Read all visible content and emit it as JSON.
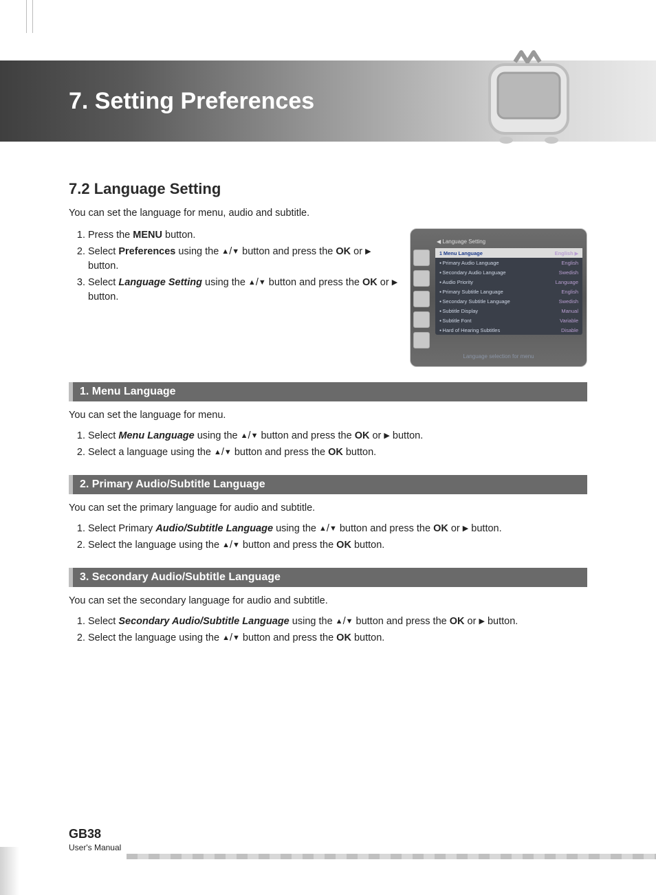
{
  "chapter_title": "7. Setting Preferences",
  "section_heading": "7.2 Language Setting",
  "section_intro": "You can set the language for menu, audio and subtitle.",
  "steps": {
    "s1_a": "Press the ",
    "s1_b": "MENU",
    "s1_c": " button.",
    "s2_a": "Select ",
    "s2_b": "Preferences",
    "s2_c": " using the ",
    "s2_d": " button and press the ",
    "s2_e": "OK",
    "s2_f": " or ",
    "s2_g": " button.",
    "s3_a": "Select ",
    "s3_b": "Language Setting",
    "s3_c": " using the ",
    "s3_d": " button and press the ",
    "s3_e": "OK",
    "s3_f": " or ",
    "s3_g": " button."
  },
  "osd": {
    "crumb": "◀ Language Setting",
    "rows": [
      {
        "label": "Menu Language",
        "value": "English"
      },
      {
        "label": "Primary Audio Language",
        "value": "English"
      },
      {
        "label": "Secondary Audio Language",
        "value": "Swedish"
      },
      {
        "label": "Audio Priority",
        "value": "Language"
      },
      {
        "label": "Primary Subtitle Language",
        "value": "English"
      },
      {
        "label": "Secondary Subtitle Language",
        "value": "Swedish"
      },
      {
        "label": "Subtitle Display",
        "value": "Manual"
      },
      {
        "label": "Subtitle Font",
        "value": "Variable"
      },
      {
        "label": "Hard of Hearing Subtitles",
        "value": "Disable"
      }
    ],
    "help": "Language selection for menu"
  },
  "sub1": {
    "bar": "1. Menu Language",
    "text": "You can set the language for menu.",
    "li1_a": "Select ",
    "li1_b": "Menu Language",
    "li1_c": " using the ",
    "li1_d": " button and press the ",
    "li1_e": "OK",
    "li1_f": " or ",
    "li1_g": " button.",
    "li2_a": "Select a language using the ",
    "li2_b": " button and press the ",
    "li2_c": "OK",
    "li2_d": " button."
  },
  "sub2": {
    "bar": "2. Primary Audio/Subtitle Language",
    "text": "You can set the primary language for audio and subtitle.",
    "li1_a": "Select Primary ",
    "li1_b": "Audio/Subtitle Language",
    "li1_c": " using the ",
    "li1_d": " button and press the ",
    "li1_e": "OK",
    "li1_f": " or ",
    "li1_g": " button.",
    "li2_a": "Select the language using the ",
    "li2_b": " button and press the ",
    "li2_c": "OK",
    "li2_d": " button."
  },
  "sub3": {
    "bar": "3. Secondary Audio/Subtitle Language",
    "text": "You can set the secondary language for audio and subtitle.",
    "li1_a": "Select ",
    "li1_b": "Secondary Audio/Subtitle Language",
    "li1_c": " using the ",
    "li1_d": " button and press the ",
    "li1_e": "OK",
    "li1_f": " or ",
    "li1_g": " button.",
    "li2_a": "Select the language using the ",
    "li2_b": " button and press the ",
    "li2_c": "OK",
    "li2_d": " button."
  },
  "footer": {
    "page": "GB38",
    "label": "User's Manual"
  },
  "glyphs": {
    "up": "▲",
    "down": "▼",
    "right": "▶"
  }
}
